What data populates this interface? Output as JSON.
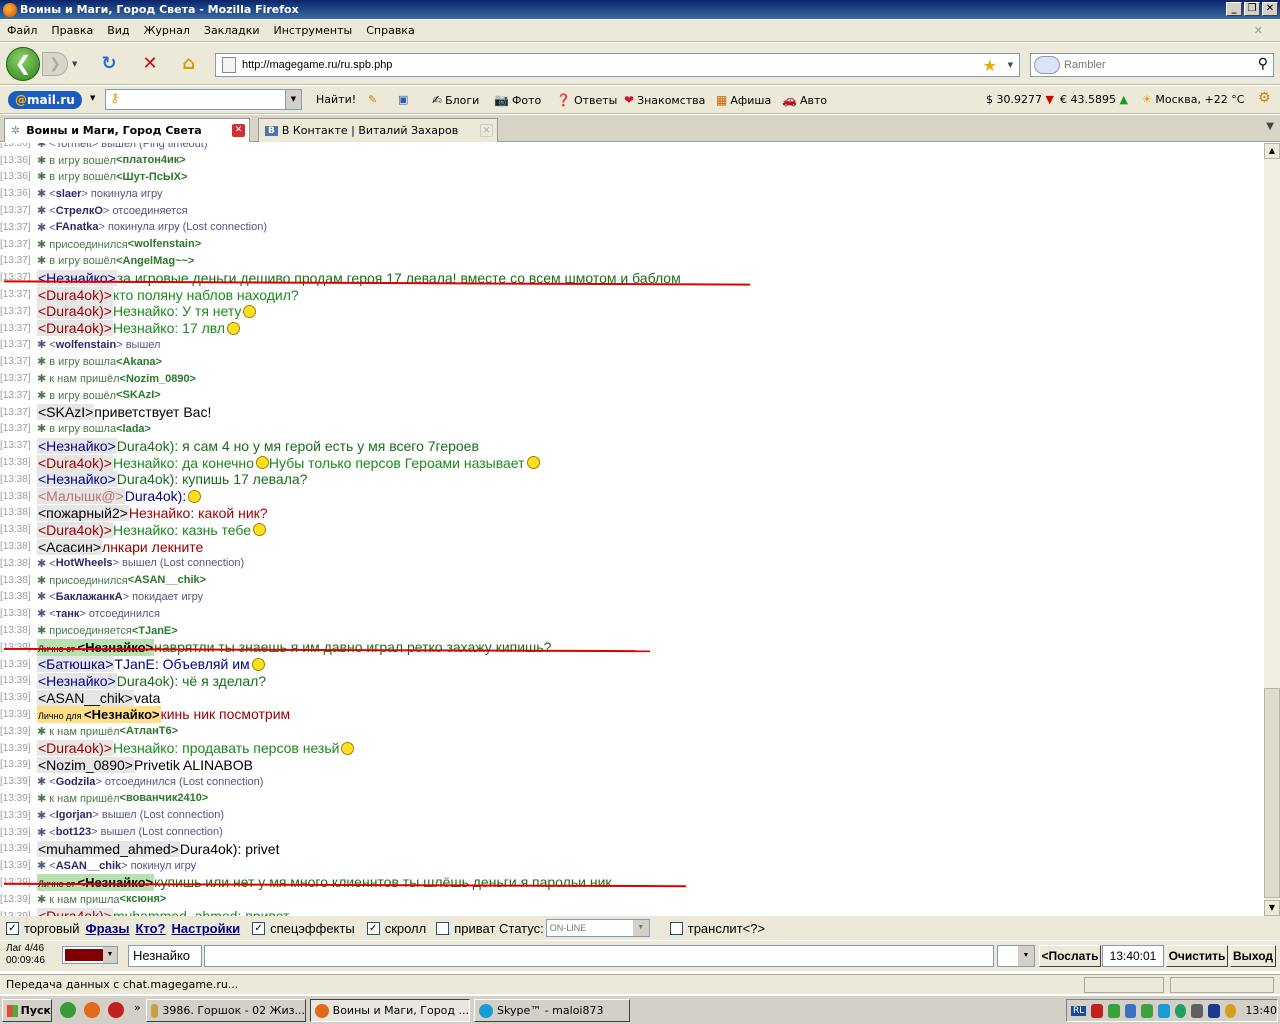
{
  "window": {
    "title": "Воины и Маги, Город Света - Mozilla Firefox"
  },
  "menu": [
    "Файл",
    "Правка",
    "Вид",
    "Журнал",
    "Закладки",
    "Инструменты",
    "Справка"
  ],
  "nav": {
    "url": "http://magegame.ru/ru.spb.php",
    "search_placeholder": "Rambler"
  },
  "mailbar": {
    "logo": "@mail.ru",
    "find": "Найти!",
    "links": [
      "Блоги",
      "Фото",
      "Ответы",
      "Знакомства",
      "Афиша",
      "Авто"
    ],
    "usd": "$ 30.9277",
    "eur": "€ 43.5895",
    "weather": "Москва, +22 °С"
  },
  "tabs": [
    {
      "label": "Воины и Маги, Город Света"
    },
    {
      "label": "В Контакте | Виталий Захаров"
    }
  ],
  "chat": [
    {
      "t": "[13:36]",
      "type": "sys",
      "text": "✱ <Tormelt> вышел (Ping timeout)"
    },
    {
      "t": "[13:36]",
      "type": "sys",
      "pre": "✱ в игру вошёл ",
      "nick": "<платон4ик>"
    },
    {
      "t": "[13:36]",
      "type": "sys",
      "pre": "✱ в игру вошёл ",
      "nick": "<Шут-ПсЫХ>"
    },
    {
      "t": "[13:36]",
      "type": "sysb",
      "pre": "✱ <",
      "nick": "slaer",
      "post": "> покинула игру"
    },
    {
      "t": "[13:37]",
      "type": "sysb",
      "pre": "✱ <",
      "nick": "СтрелкО",
      "post": "> отсоединяется"
    },
    {
      "t": "[13:37]",
      "type": "sysb",
      "pre": "✱ <",
      "nick": "FAnatka",
      "post": "> покинула игру (Lost connection)"
    },
    {
      "t": "[13:37]",
      "type": "sys",
      "pre": "✱ присоединился ",
      "nick": "<wolfenstain>"
    },
    {
      "t": "[13:37]",
      "type": "sys",
      "pre": "✱ в игру вошёл ",
      "nick": "<AngelMag~~>"
    },
    {
      "t": "[13:37]",
      "type": "msg",
      "nick": "<Незнайко>",
      "ncolor": "#00008b",
      "text": " за игровые деньги дешиво продам героя 17 левала! вместе со всем шмотом и баблом",
      "tcolor": "#1a6e1a"
    },
    {
      "t": "[13:37]",
      "type": "msg",
      "nick": "<Dura4ok)>",
      "ncolor": "#a00000",
      "text": " кто поляну наблов находил?",
      "tcolor": "#1a8a1a"
    },
    {
      "t": "[13:37]",
      "type": "msg",
      "nick": "<Dura4ok)>",
      "ncolor": "#a00000",
      "text": " Незнайко: У тя нету",
      "tcolor": "#1a8a1a",
      "smile": true
    },
    {
      "t": "[13:37]",
      "type": "msg",
      "nick": "<Dura4ok)>",
      "ncolor": "#a00000",
      "text": " Незнайко: 17 лвл",
      "tcolor": "#1a8a1a",
      "smile": true
    },
    {
      "t": "[13:37]",
      "type": "sysb",
      "pre": "✱ <",
      "nick": "wolfenstain",
      "post": "> вышел"
    },
    {
      "t": "[13:37]",
      "type": "sys",
      "pre": "✱ в игру вошла ",
      "nick": "<Akana>"
    },
    {
      "t": "[13:37]",
      "type": "sys",
      "pre": "✱ к нам пришёл ",
      "nick": "<Nozim_0890>"
    },
    {
      "t": "[13:37]",
      "type": "sys",
      "pre": "✱ в игру вошёл ",
      "nick": "<SKAzI>"
    },
    {
      "t": "[13:37]",
      "type": "msg",
      "nick": "<SKAzI>",
      "ncolor": "#000",
      "text": " приветствует Вас!",
      "tcolor": "#000"
    },
    {
      "t": "[13:37]",
      "type": "sys",
      "pre": "✱ в игру вошла ",
      "nick": "<lada>"
    },
    {
      "t": "[13:37]",
      "type": "msg",
      "nick": "<Незнайко>",
      "ncolor": "#00008b",
      "text": " Dura4ok): я сам 4 но у мя герой есть у мя всего 7героев",
      "tcolor": "#1a6e1a"
    },
    {
      "t": "[13:38]",
      "type": "msg",
      "nick": "<Dura4ok)>",
      "ncolor": "#a00000",
      "text": " Незнайко: да конечно",
      "tcolor": "#1a8a1a",
      "smile": true,
      "text2": " Нубы только персов Героами называет",
      "smile2": true
    },
    {
      "t": "[13:38]",
      "type": "msg",
      "nick": "<Незнайко>",
      "ncolor": "#00008b",
      "text": " Dura4ok): купишь 17 левала?",
      "tcolor": "#1a6e1a"
    },
    {
      "t": "[13:38]",
      "type": "msg",
      "nick": "<Малышк@>",
      "ncolor": "#c07070",
      "text": " Dura4ok):",
      "tcolor": "#00008b",
      "smile": true
    },
    {
      "t": "[13:38]",
      "type": "msg",
      "nick": "<пожарный2>",
      "ncolor": "#000",
      "text": " Незнайко: какой ник?",
      "tcolor": "#a00000"
    },
    {
      "t": "[13:38]",
      "type": "msg",
      "nick": "<Dura4ok)>",
      "ncolor": "#a00000",
      "text": " Незнайко: казнь тебе",
      "tcolor": "#1a8a1a",
      "smile": true
    },
    {
      "t": "[13:38]",
      "type": "msg",
      "nick": "<Асасин>",
      "ncolor": "#000",
      "text": " лнкари лекните",
      "tcolor": "#a00000"
    },
    {
      "t": "[13:38]",
      "type": "sysb",
      "pre": "✱ <",
      "nick": "HotWheels",
      "post": "> вышел (Lost connection)"
    },
    {
      "t": "[13:38]",
      "type": "sys",
      "pre": "✱ присоединился ",
      "nick": "<ASAN__chik>"
    },
    {
      "t": "[13:38]",
      "type": "sysb",
      "pre": "✱ <",
      "nick": "БаклажанкА",
      "post": "> покидает игру"
    },
    {
      "t": "[13:38]",
      "type": "sysb",
      "pre": "✱ <",
      "nick": "танк",
      "post": "> отсоединился"
    },
    {
      "t": "[13:38]",
      "type": "sys",
      "pre": "✱ присоединяется ",
      "nick": "<TJanE>"
    },
    {
      "t": "[13:39]",
      "type": "priv",
      "label": "Лично от ",
      "nick": "<Незнайко>",
      "text": " наврятли ты знаешь я им давно играл ретко захажу кипишь?",
      "tcolor": "#1a6e1a"
    },
    {
      "t": "[13:39]",
      "type": "msg",
      "nick": "<Батюшка>",
      "ncolor": "#00008b",
      "text": " TJanE: Объевляй им",
      "tcolor": "#00008b",
      "smile": true
    },
    {
      "t": "[13:39]",
      "type": "msg",
      "nick": "<Незнайко>",
      "ncolor": "#00008b",
      "text": " Dura4ok): чё я зделал?",
      "tcolor": "#1a6e1a"
    },
    {
      "t": "[13:39]",
      "type": "msg",
      "nick": "<ASAN__chik>",
      "ncolor": "#000",
      "text": " vata",
      "tcolor": "#000"
    },
    {
      "t": "[13:39]",
      "type": "privy",
      "label": "Лично для ",
      "nick": "<Незнайко>",
      "text": " кинь ник посмотрим",
      "tcolor": "#a00000"
    },
    {
      "t": "[13:39]",
      "type": "sys",
      "pre": "✱ к нам пришёл ",
      "nick": "<АтланТ6>"
    },
    {
      "t": "[13:39]",
      "type": "msg",
      "nick": "<Dura4ok)>",
      "ncolor": "#a00000",
      "text": " Незнайко: продавать персов незьй",
      "tcolor": "#1a8a1a",
      "smile": true
    },
    {
      "t": "[13:39]",
      "type": "msg",
      "nick": "<Nozim_0890>",
      "ncolor": "#000",
      "text": " Privetik ALINABOB",
      "tcolor": "#000"
    },
    {
      "t": "[13:39]",
      "type": "sysb",
      "pre": "✱ <",
      "nick": "Godzila",
      "post": "> отсоединился (Lost connection)"
    },
    {
      "t": "[13:39]",
      "type": "sys",
      "pre": "✱ к нам пришёл ",
      "nick": "<вованчик2410>"
    },
    {
      "t": "[13:39]",
      "type": "sysb",
      "pre": "✱ <",
      "nick": "Igorjan",
      "post": "> вышел (Lost connection)"
    },
    {
      "t": "[13:39]",
      "type": "sysb",
      "pre": "✱ <",
      "nick": "bot123",
      "post": "> вышел (Lost connection)"
    },
    {
      "t": "[13:39]",
      "type": "msg",
      "nick": "<muhammed_ahmed>",
      "ncolor": "#000",
      "text": " Dura4ok): privet",
      "tcolor": "#000"
    },
    {
      "t": "[13:39]",
      "type": "sysb",
      "pre": "✱ <",
      "nick": "ASAN__chik",
      "post": "> покинул игру"
    },
    {
      "t": "[13:39]",
      "type": "priv",
      "label": "Лично от ",
      "nick": "<Незнайко>",
      "text": " купишь или нет у мя много клиеннтов ты шлёшь деньги я парольи ник",
      "tcolor": "#1a6e1a"
    },
    {
      "t": "[13:39]",
      "type": "sys",
      "pre": "✱ к нам пришла ",
      "nick": "<ксюня>"
    },
    {
      "t": "[13:39]",
      "type": "msg",
      "nick": "<Dura4ok)>",
      "ncolor": "#a00000",
      "text": " muhammed_ahmed: привет",
      "tcolor": "#1a8a1a"
    }
  ],
  "options": {
    "trade": "торговый",
    "phrases": "Фразы",
    "who": "Кто?",
    "settings": "Настройки",
    "effects": "спецэффекты",
    "scroll": "скролл",
    "private": "приват Статус:",
    "status": "ON-LINE",
    "translit": "транслит",
    "translit_help": "<?>"
  },
  "input": {
    "lag": "Лаг 4/46",
    "time_online": "00:09:46",
    "nick": "Незнайко",
    "send": "<Послать",
    "clock": "13:40:01",
    "clear": "Очистить",
    "exit": "Выход"
  },
  "status": "Передача данных с chat.magegame.ru...",
  "taskbar": {
    "start": "Пуск",
    "items": [
      "3986. Горшок - 02 Жиз...",
      "Воины и Маги, Город ...",
      "Skype™ - maloi873"
    ],
    "lang": "RL",
    "time": "13:40"
  }
}
